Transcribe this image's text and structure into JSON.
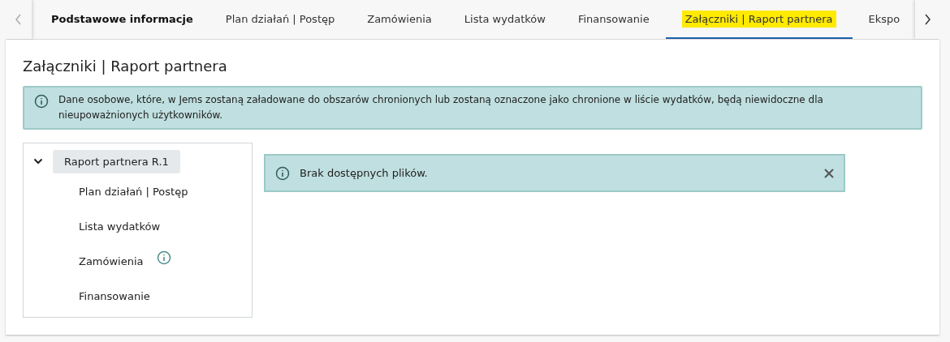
{
  "tabs": [
    {
      "label": "Podstawowe informacje",
      "selected": false,
      "bold": true,
      "highlighted": false
    },
    {
      "label": "Plan działań | Postęp",
      "selected": false,
      "bold": false,
      "highlighted": false
    },
    {
      "label": "Zamówienia",
      "selected": false,
      "bold": false,
      "highlighted": false
    },
    {
      "label": "Lista wydatków",
      "selected": false,
      "bold": false,
      "highlighted": false
    },
    {
      "label": "Finansowanie",
      "selected": false,
      "bold": false,
      "highlighted": false
    },
    {
      "label": "Załączniki | Raport partnera",
      "selected": true,
      "bold": false,
      "highlighted": true
    },
    {
      "label": "Ekspo",
      "selected": false,
      "bold": false,
      "highlighted": false
    }
  ],
  "page_title": "Załączniki | Raport partnera",
  "info_banner": {
    "text": "Dane osobowe, które, w Jems zostaną załadowane do obszarów chronionych lub zostaną oznaczone jako chronione w liście wydatków, będą niewidoczne dla nieupoważnionych użytkowników."
  },
  "tree": [
    {
      "label": "Raport partnera R.1",
      "expanded": true,
      "selected": true,
      "children": [
        {
          "label": "Plan działań | Postęp",
          "selected": false,
          "has_info": false
        },
        {
          "label": "Lista wydatków",
          "selected": false,
          "has_info": false
        },
        {
          "label": "Zamówienia",
          "selected": false,
          "has_info": true
        },
        {
          "label": "Finansowanie",
          "selected": false,
          "has_info": false
        }
      ]
    }
  ],
  "notice": {
    "text": "Brak dostępnych plików.",
    "closable": true
  }
}
